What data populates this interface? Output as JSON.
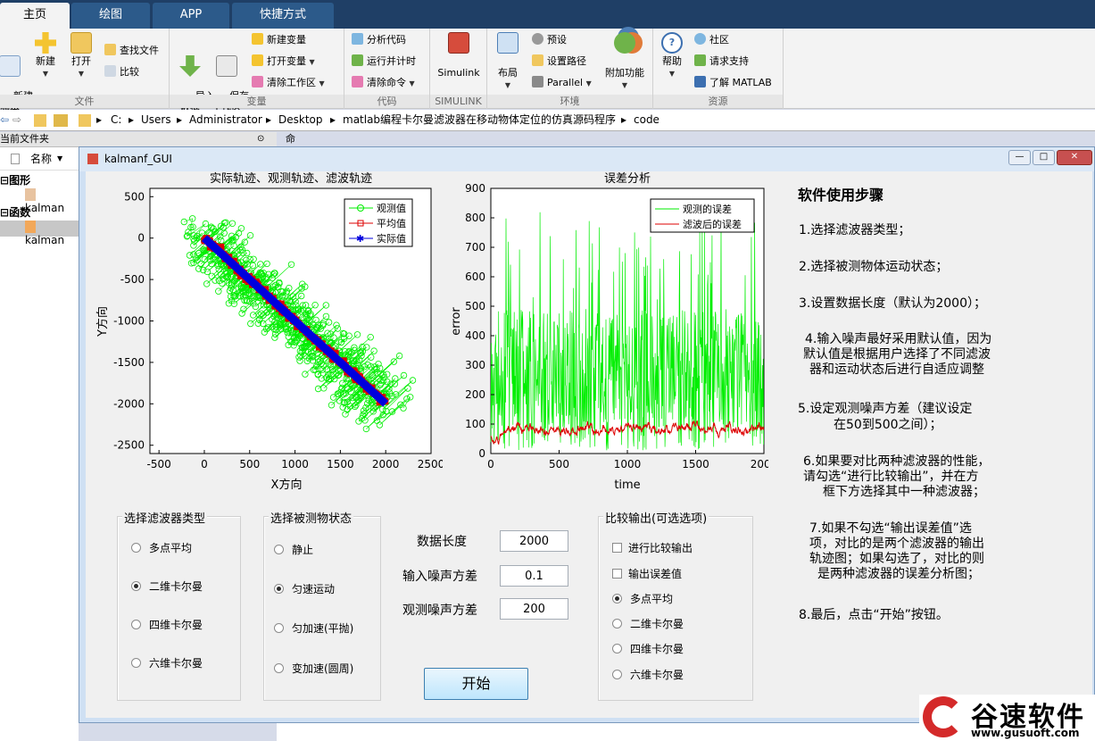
{
  "ribbon": {
    "tabs": [
      "主页",
      "绘图",
      "APP",
      "快捷方式"
    ],
    "file_group": {
      "label": "文件",
      "new_script": "新建\n脚本",
      "new": "新建",
      "open": "打开",
      "find_files": "查找文件",
      "compare": "比较"
    },
    "variable_group": {
      "label": "变量",
      "import": "导入\n数据",
      "save_ws": "保存\n工作区",
      "new_var": "新建变量",
      "open_var": "打开变量",
      "clear_ws": "清除工作区"
    },
    "code_group": {
      "label": "代码",
      "analyze": "分析代码",
      "run_time": "运行并计时",
      "clear_cmd": "清除命令"
    },
    "simulink_group": {
      "label": "SIMULINK",
      "simulink": "Simulink"
    },
    "env_group": {
      "label": "环境",
      "layout": "布局",
      "prefs": "预设",
      "set_path": "设置路径",
      "parallel": "Parallel",
      "addons": "附加功能"
    },
    "resources_group": {
      "label": "资源",
      "help": "帮助",
      "community": "社区",
      "support": "请求支持",
      "learn": "了解 MATLAB"
    }
  },
  "path": [
    "C:",
    "Users",
    "Administrator",
    "Desktop",
    "matlab编程卡尔曼滤波器在移动物体定位的仿真源码程序",
    "code"
  ],
  "left_panel": {
    "title": "当前文件夹",
    "col_name": "名称",
    "section_figures": "图形",
    "section_functions": "函数",
    "file1": "kalman",
    "file2": "kalman"
  },
  "cmd_panel": {
    "title": "命令行窗口"
  },
  "window": {
    "title": "kalmanf_GUI"
  },
  "colors": {
    "observed": "#00ee00",
    "average": "#dd0000",
    "actual": "#0000dd",
    "error_obs": "#00ee00",
    "error_filt": "#dd0000"
  },
  "chart_data": [
    {
      "type": "scatter",
      "title": "实际轨迹、观测轨迹、滤波轨迹",
      "xlabel": "X方向",
      "ylabel": "Y方向",
      "xlim": [
        -600,
        2500
      ],
      "ylim": [
        -2600,
        600
      ],
      "xticks": [
        -500,
        0,
        500,
        1000,
        1500,
        2000,
        2500
      ],
      "yticks": [
        500,
        0,
        -500,
        -1000,
        -1500,
        -2000,
        -2500
      ],
      "legend_position": "top-right",
      "series": [
        {
          "name": "观测值",
          "marker": "circle",
          "color": "#00ee00"
        },
        {
          "name": "平均值",
          "marker": "square",
          "color": "#dd0000"
        },
        {
          "name": "实际值",
          "marker": "star",
          "color": "#0000dd"
        }
      ],
      "actual_line": {
        "x": [
          0,
          2000
        ],
        "y": [
          0,
          -2000
        ]
      }
    },
    {
      "type": "line",
      "title": "误差分析",
      "xlabel": "time",
      "ylabel": "error",
      "xlim": [
        0,
        2000
      ],
      "ylim": [
        0,
        900
      ],
      "xticks": [
        0,
        500,
        1000,
        1500,
        2000
      ],
      "yticks": [
        0,
        100,
        200,
        300,
        400,
        500,
        600,
        700,
        800,
        900
      ],
      "legend_position": "top-right",
      "series": [
        {
          "name": "观测的误差",
          "color": "#00ee00",
          "typical_range": [
            0,
            600
          ]
        },
        {
          "name": "滤波后的误差",
          "color": "#dd0000",
          "typical_range": [
            40,
            130
          ]
        }
      ]
    }
  ],
  "filter_panel": {
    "title": "选择滤波器类型",
    "options": [
      "多点平均",
      "二维卡尔曼",
      "四维卡尔曼",
      "六维卡尔曼"
    ],
    "selected": 1
  },
  "motion_panel": {
    "title": "选择被测物状态",
    "options": [
      "静止",
      "匀速运动",
      "匀加速(平抛)",
      "变加速(圆周)"
    ],
    "selected": 1
  },
  "inputs": {
    "length_label": "数据长度",
    "length_value": "2000",
    "input_noise_label": "输入噪声方差",
    "input_noise_value": "0.1",
    "obs_noise_label": "观测噪声方差",
    "obs_noise_value": "200"
  },
  "start_button": "开始",
  "compare_panel": {
    "title": "比较输出(可选选项)",
    "check_compare": "进行比较输出",
    "check_error": "输出误差值",
    "options": [
      "多点平均",
      "二维卡尔曼",
      "四维卡尔曼",
      "六维卡尔曼"
    ],
    "selected": 0
  },
  "help": {
    "title": "软件使用步骤",
    "s1": "1.选择滤波器类型；",
    "s2": "2.选择被测物体运动状态；",
    "s3": "3.设置数据长度（默认为2000）；",
    "s4a": "4.输入噪声最好采用默认值，因为",
    "s4b": "默认值是根据用户选择了不同滤波",
    "s4c": "器和运动状态后进行自适应调整",
    "s5a": "5.设定观测噪声方差（建议设定",
    "s5b": "在50到500之间）；",
    "s6a": "6.如果要对比两种滤波器的性能，",
    "s6b": "请勾选“进行比较输出”，并在方",
    "s6c": "框下方选择其中一种滤波器；",
    "s7a": "7.如果不勾选“输出误差值”选",
    "s7b": "项，对比的是两个滤波器的输出",
    "s7c": "轨迹图；如果勾选了，对比的则",
    "s7d": "是两种滤波器的误差分析图；",
    "s8": "8.最后，点击“开始”按钮。"
  },
  "watermark": {
    "brand": "谷速软件",
    "url": "www.gusuoft.com"
  }
}
